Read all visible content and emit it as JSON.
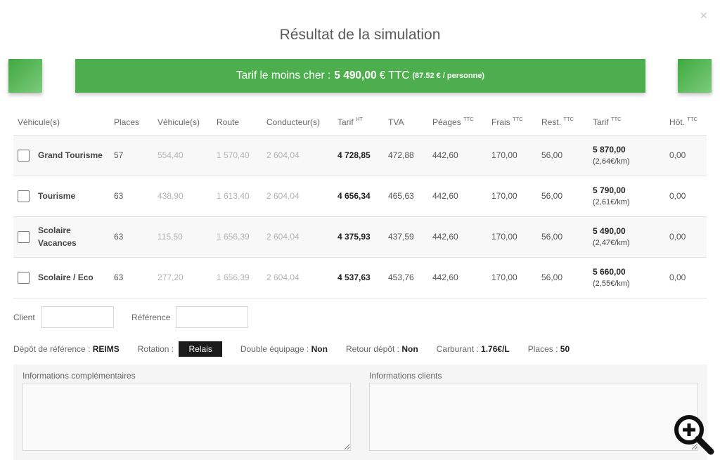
{
  "modal": {
    "close_icon": "close-icon",
    "title": "Résultat de la simulation"
  },
  "banner": {
    "prefix": "Tarif le moins cher :",
    "price": "5 490,00",
    "currency": "€ TTC",
    "per_person": "(87.52 € / personne)",
    "color": "#4cae4c"
  },
  "table": {
    "headers": [
      {
        "label": "Véhicule(s)",
        "sup": ""
      },
      {
        "label": "Places",
        "sup": ""
      },
      {
        "label": "Véhicule(s)",
        "sup": ""
      },
      {
        "label": "Route",
        "sup": ""
      },
      {
        "label": "Conducteur(s)",
        "sup": ""
      },
      {
        "label": "Tarif",
        "sup": "HT"
      },
      {
        "label": "TVA",
        "sup": ""
      },
      {
        "label": "Péages",
        "sup": "TTC"
      },
      {
        "label": "Frais",
        "sup": "TTC"
      },
      {
        "label": "Rest.",
        "sup": "TTC"
      },
      {
        "label": "Tarif",
        "sup": "TTC"
      },
      {
        "label": "Hôt.",
        "sup": "TTC"
      }
    ],
    "rows": [
      {
        "name": "Grand Tourisme",
        "places": "57",
        "vehicule": "554,40",
        "route": "1 570,40",
        "conducteur": "2 604,04",
        "tarif_ht": "4 728,85",
        "tva": "472,88",
        "peages": "442,60",
        "frais": "170,00",
        "rest": "56,00",
        "tarif_ttc": "5 870,00",
        "per_km": "(2,64€/km)",
        "hotel": "0,00"
      },
      {
        "name": "Tourisme",
        "places": "63",
        "vehicule": "438,90",
        "route": "1 613,40",
        "conducteur": "2 604,04",
        "tarif_ht": "4 656,34",
        "tva": "465,63",
        "peages": "442,60",
        "frais": "170,00",
        "rest": "56,00",
        "tarif_ttc": "5 790,00",
        "per_km": "(2,61€/km)",
        "hotel": "0,00"
      },
      {
        "name": "Scolaire Vacances",
        "places": "63",
        "vehicule": "115,50",
        "route": "1 656,39",
        "conducteur": "2 604,04",
        "tarif_ht": "4 375,93",
        "tva": "437,59",
        "peages": "442,60",
        "frais": "170,00",
        "rest": "56,00",
        "tarif_ttc": "5 490,00",
        "per_km": "(2,47€/km)",
        "hotel": "0,00"
      },
      {
        "name": "Scolaire / Eco",
        "places": "63",
        "vehicule": "277,20",
        "route": "1 656,39",
        "conducteur": "2 604,04",
        "tarif_ht": "4 537,63",
        "tva": "453,76",
        "peages": "442,60",
        "frais": "170,00",
        "rest": "56,00",
        "tarif_ttc": "5 660,00",
        "per_km": "(2,55€/km)",
        "hotel": "0,00"
      }
    ]
  },
  "form": {
    "client_label": "Client",
    "client_value": "",
    "reference_label": "Référence",
    "reference_value": ""
  },
  "info": {
    "depot_label": "Dépôt de référence :",
    "depot_value": "REIMS",
    "rotation_label": "Rotation :",
    "rotation_value": "Relais",
    "double_label": "Double équipage :",
    "double_value": "Non",
    "retour_label": "Retour dépôt :",
    "retour_value": "Non",
    "carburant_label": "Carburant :",
    "carburant_value": "1.76€/L",
    "places_label": "Places :",
    "places_value": "50"
  },
  "panels": {
    "complementaires_label": "Informations complémentaires",
    "clients_label": "Informations clients"
  },
  "zoom_icon": "zoom-in-icon"
}
